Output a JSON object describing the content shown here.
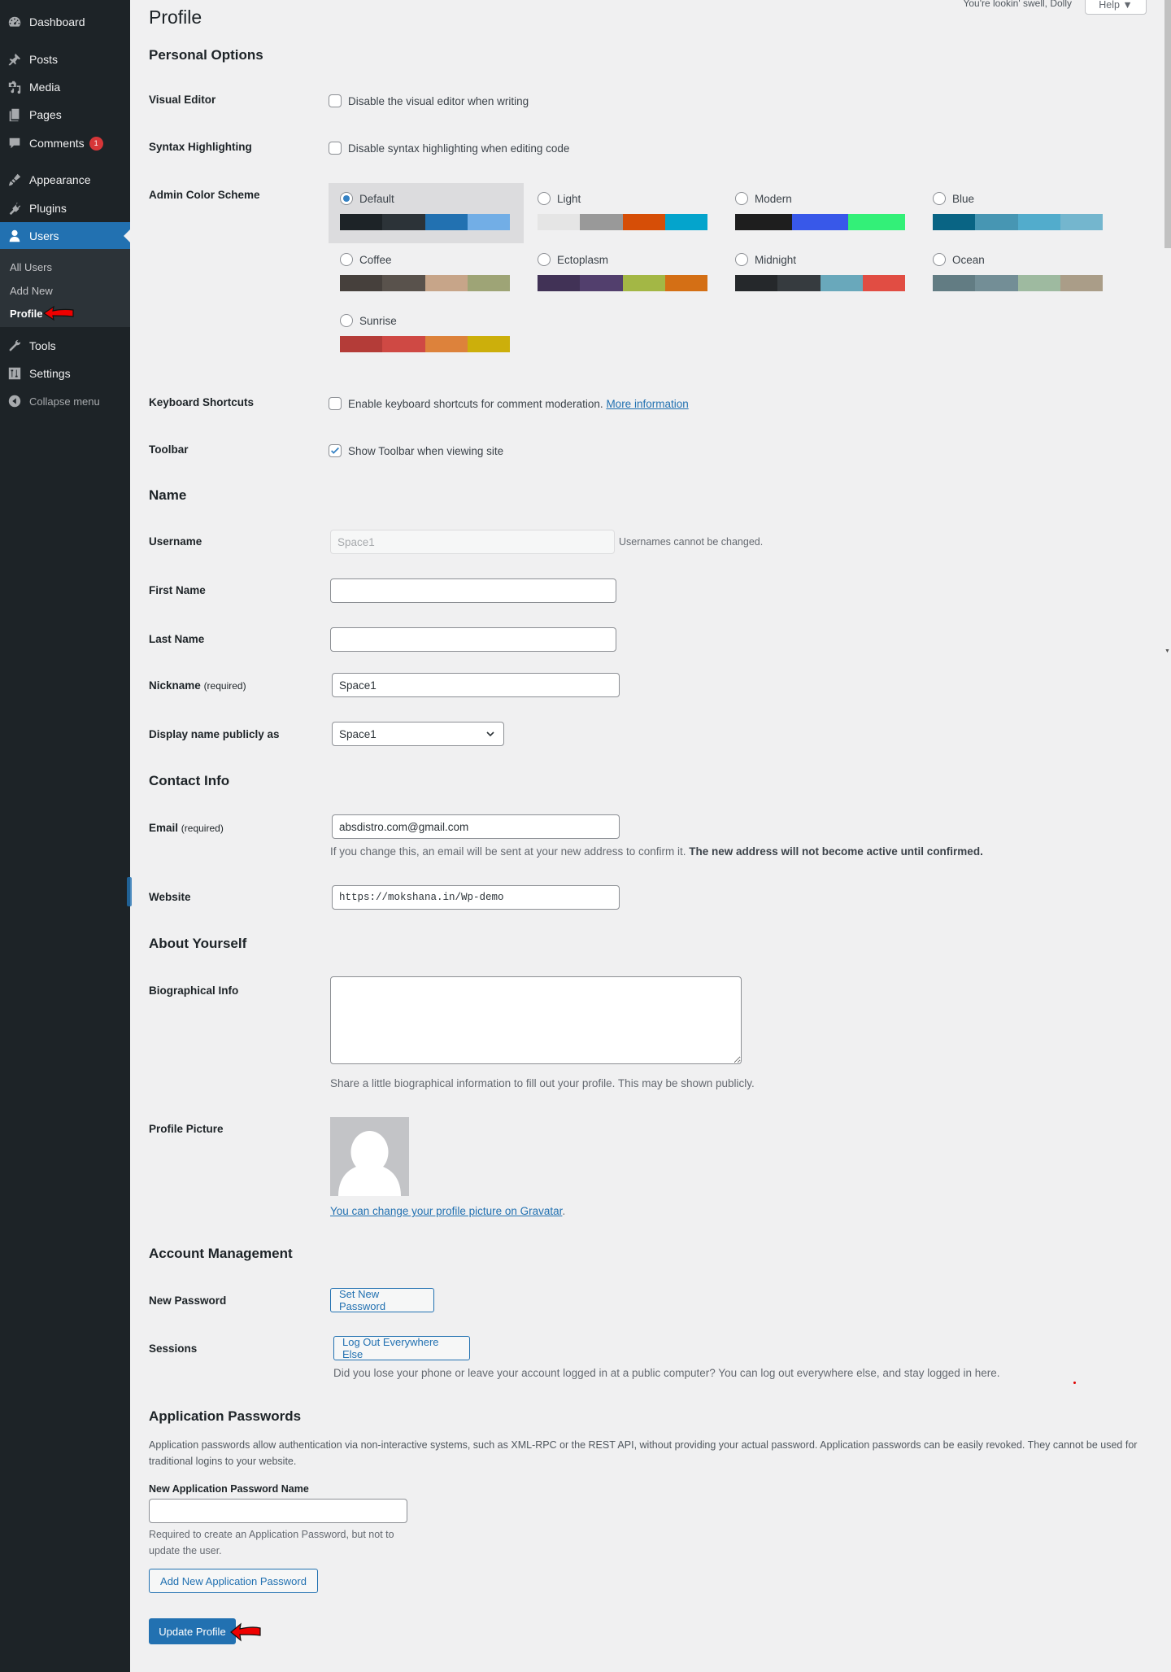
{
  "sidebar": {
    "items": [
      {
        "label": "Dashboard",
        "icon": "dashboard-icon"
      },
      {
        "label": "Posts",
        "icon": "pin-icon"
      },
      {
        "label": "Media",
        "icon": "media-icon"
      },
      {
        "label": "Pages",
        "icon": "pages-icon"
      },
      {
        "label": "Comments",
        "icon": "comment-icon",
        "badge": "1"
      },
      {
        "label": "Appearance",
        "icon": "brush-icon"
      },
      {
        "label": "Plugins",
        "icon": "plugin-icon"
      },
      {
        "label": "Users",
        "icon": "user-icon",
        "active": true
      },
      {
        "label": "Tools",
        "icon": "wrench-icon"
      },
      {
        "label": "Settings",
        "icon": "settings-icon"
      }
    ],
    "submenu": [
      {
        "label": "All Users"
      },
      {
        "label": "Add New"
      },
      {
        "label": "Profile",
        "current": true
      }
    ],
    "collapse_label": "Collapse menu"
  },
  "header": {
    "title": "Profile",
    "greeting": "You're lookin' swell, Dolly",
    "help_label": "Help ▼"
  },
  "personal_options": {
    "heading": "Personal Options",
    "visual_editor": {
      "label": "Visual Editor",
      "text": "Disable the visual editor when writing",
      "checked": false
    },
    "syntax_highlighting": {
      "label": "Syntax Highlighting",
      "text": "Disable syntax highlighting when editing code",
      "checked": false
    },
    "color_scheme": {
      "label": "Admin Color Scheme",
      "selected": "Default",
      "schemes": [
        {
          "name": "Default",
          "colors": [
            "#1d2327",
            "#2c3338",
            "#2271b1",
            "#72aee6"
          ]
        },
        {
          "name": "Light",
          "colors": [
            "#e5e5e5",
            "#999999",
            "#d64e07",
            "#04a4cc"
          ]
        },
        {
          "name": "Modern",
          "colors": [
            "#1e1e1e",
            "#3858e9",
            "#33f078"
          ]
        },
        {
          "name": "Blue",
          "colors": [
            "#096484",
            "#4796b3",
            "#52accc",
            "#74b6ce"
          ]
        },
        {
          "name": "Coffee",
          "colors": [
            "#46403c",
            "#59524c",
            "#c7a589",
            "#9ea476"
          ]
        },
        {
          "name": "Ectoplasm",
          "colors": [
            "#413256",
            "#523f6d",
            "#a3b745",
            "#d46f15"
          ]
        },
        {
          "name": "Midnight",
          "colors": [
            "#25282b",
            "#363b3f",
            "#69a8bb",
            "#e14d43"
          ]
        },
        {
          "name": "Ocean",
          "colors": [
            "#627c83",
            "#738e96",
            "#9ebaa0",
            "#aa9d88"
          ]
        },
        {
          "name": "Sunrise",
          "colors": [
            "#b43c38",
            "#cf4944",
            "#dd823b",
            "#ccaf0b"
          ]
        }
      ]
    },
    "keyboard_shortcuts": {
      "label": "Keyboard Shortcuts",
      "text": "Enable keyboard shortcuts for comment moderation.",
      "link": "More information",
      "checked": false
    },
    "toolbar": {
      "label": "Toolbar",
      "text": "Show Toolbar when viewing site",
      "checked": true
    }
  },
  "name": {
    "heading": "Name",
    "username": {
      "label": "Username",
      "value": "Space1",
      "note": "Usernames cannot be changed."
    },
    "first_name": {
      "label": "First Name",
      "value": ""
    },
    "last_name": {
      "label": "Last Name",
      "value": ""
    },
    "nickname": {
      "label": "Nickname",
      "required": "(required)",
      "value": "Space1"
    },
    "display_name": {
      "label": "Display name publicly as",
      "value": "Space1"
    }
  },
  "contact": {
    "heading": "Contact Info",
    "email": {
      "label": "Email",
      "required": "(required)",
      "value": "absdistro.com@gmail.com",
      "note": "If you change this, an email will be sent at your new address to confirm it.",
      "note_bold": "The new address will not become active until confirmed."
    },
    "website": {
      "label": "Website",
      "value": "https://mokshana.in/Wp-demo"
    }
  },
  "about": {
    "heading": "About Yourself",
    "bio": {
      "label": "Biographical Info",
      "value": "",
      "note": "Share a little biographical information to fill out your profile. This may be shown publicly."
    },
    "picture": {
      "label": "Profile Picture",
      "link": "You can change your profile picture on Gravatar",
      "suffix": "."
    }
  },
  "account": {
    "heading": "Account Management",
    "new_password": {
      "label": "New Password",
      "button": "Set New Password"
    },
    "sessions": {
      "label": "Sessions",
      "button": "Log Out Everywhere Else",
      "note": "Did you lose your phone or leave your account logged in at a public computer? You can log out everywhere else, and stay logged in here."
    }
  },
  "app_passwords": {
    "heading": "Application Passwords",
    "description": "Application passwords allow authentication via non-interactive systems, such as XML-RPC or the REST API, without providing your actual password. Application passwords can be easily revoked. They cannot be used for traditional logins to your website.",
    "name_label": "New Application Password Name",
    "name_value": "",
    "name_note": "Required to create an Application Password, but not to update the user.",
    "add_button": "Add New Application Password"
  },
  "submit": {
    "label": "Update Profile"
  }
}
